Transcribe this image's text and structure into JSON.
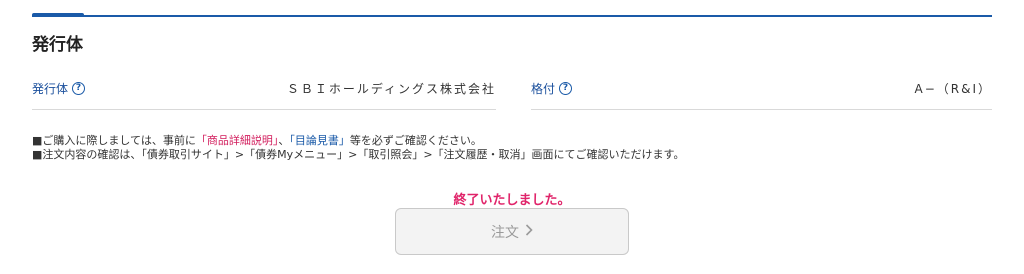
{
  "section": {
    "title": "発行体"
  },
  "fields": [
    {
      "label": "発行体",
      "value": "ＳＢＩホールディングス株式会社"
    },
    {
      "label": "格付",
      "value": "A−（R&I）"
    }
  ],
  "notes": {
    "line1_prefix": "■ご購入に際しましては、事前に",
    "line1_link1": "「商品詳細説明」",
    "line1_sep": "、",
    "line1_link2": "「目論見書」",
    "line1_suffix": "等を必ずご確認ください。",
    "line2": "■注文内容の確認は、「債券取引サイト」>「債券Myメニュー」>「取引照会」>「注文履歴・取消」画面にてご確認いただけます。"
  },
  "status": {
    "message": "終了いたしました。"
  },
  "order_button": {
    "label": "注文",
    "icon": "chevron-right-icon",
    "state": "disabled"
  },
  "colors": {
    "accent": "#1a5aa8",
    "alert": "#e0246a"
  }
}
